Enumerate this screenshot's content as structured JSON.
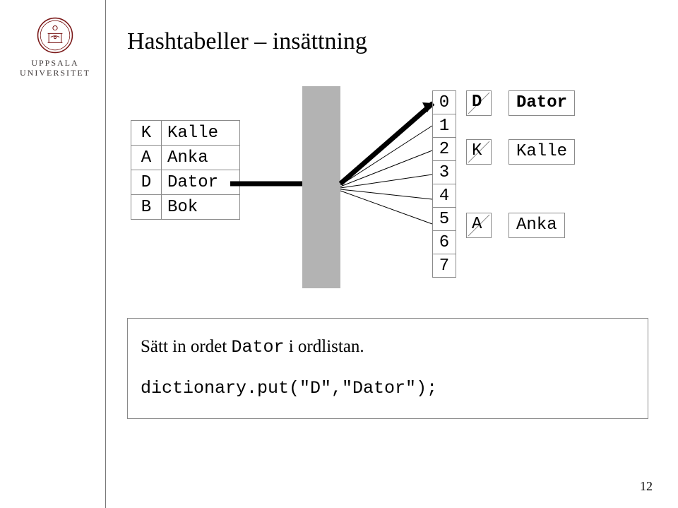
{
  "university": {
    "line1": "UPPSALA",
    "line2": "UNIVERSITET"
  },
  "title": "Hashtabeller – insättning",
  "left_table": [
    {
      "key": "K",
      "value": "Kalle"
    },
    {
      "key": "A",
      "value": "Anka"
    },
    {
      "key": "D",
      "value": "Dator"
    },
    {
      "key": "B",
      "value": "Bok"
    }
  ],
  "indices": [
    "0",
    "1",
    "2",
    "3",
    "4",
    "5",
    "6",
    "7"
  ],
  "buckets": {
    "0": {
      "key": "D",
      "value": "Dator"
    },
    "2": {
      "key": "K",
      "value": "Kalle"
    },
    "5": {
      "key": "A",
      "value": "Anka"
    }
  },
  "highlighted_index": 0,
  "thick_arrow_source_row": 2,
  "caption": {
    "line1_prefix": "Sätt in ordet ",
    "line1_mono": "Dator",
    "line1_suffix": " i ordlistan.",
    "line2_mono": "dictionary.put(\"D\",\"Dator\");"
  },
  "page_number": "12",
  "chart_data": {
    "type": "table",
    "title": "Hashtabeller – insättning",
    "input_pairs": [
      {
        "key": "K",
        "value": "Kalle"
      },
      {
        "key": "A",
        "value": "Anka"
      },
      {
        "key": "D",
        "value": "Dator"
      },
      {
        "key": "B",
        "value": "Bok"
      }
    ],
    "hash_table": {
      "size": 8,
      "slots": [
        {
          "index": 0,
          "key": "D",
          "value": "Dator"
        },
        {
          "index": 1,
          "key": null,
          "value": null
        },
        {
          "index": 2,
          "key": "K",
          "value": "Kalle"
        },
        {
          "index": 3,
          "key": null,
          "value": null
        },
        {
          "index": 4,
          "key": null,
          "value": null
        },
        {
          "index": 5,
          "key": "A",
          "value": "Anka"
        },
        {
          "index": 6,
          "key": null,
          "value": null
        },
        {
          "index": 7,
          "key": null,
          "value": null
        }
      ]
    },
    "operation": "dictionary.put(\"D\",\"Dator\");",
    "hash_arrows": [
      {
        "from_key": "D",
        "to_index": 0,
        "emphasized": true
      },
      {
        "to_index": 1
      },
      {
        "to_index": 2
      },
      {
        "to_index": 3
      },
      {
        "to_index": 4
      },
      {
        "to_index": 5
      }
    ]
  }
}
